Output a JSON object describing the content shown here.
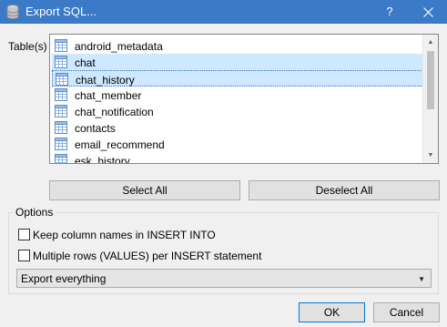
{
  "window": {
    "title": "Export SQL...",
    "help_label": "?",
    "close_label": "✕"
  },
  "tables": {
    "label": "Table(s)",
    "items": [
      {
        "label": "android_metadata",
        "state": "normal"
      },
      {
        "label": "chat",
        "state": "selected"
      },
      {
        "label": "chat_history",
        "state": "focused"
      },
      {
        "label": "chat_member",
        "state": "normal"
      },
      {
        "label": "chat_notification",
        "state": "normal"
      },
      {
        "label": "contacts",
        "state": "normal"
      },
      {
        "label": "email_recommend",
        "state": "normal"
      },
      {
        "label": "esk_history",
        "state": "normal"
      }
    ]
  },
  "buttons": {
    "select_all": "Select All",
    "deselect_all": "Deselect All",
    "ok": "OK",
    "cancel": "Cancel"
  },
  "options": {
    "title": "Options",
    "keep_column_names": {
      "label": "Keep column names in INSERT INTO",
      "checked": false
    },
    "multiple_rows": {
      "label": "Multiple rows (VALUES) per INSERT statement",
      "checked": false
    },
    "export_mode": {
      "selected": "Export everything"
    }
  },
  "colors": {
    "titlebar": "#3a7ac7",
    "selection": "#cde8ff",
    "default_button_border": "#0078d7"
  }
}
